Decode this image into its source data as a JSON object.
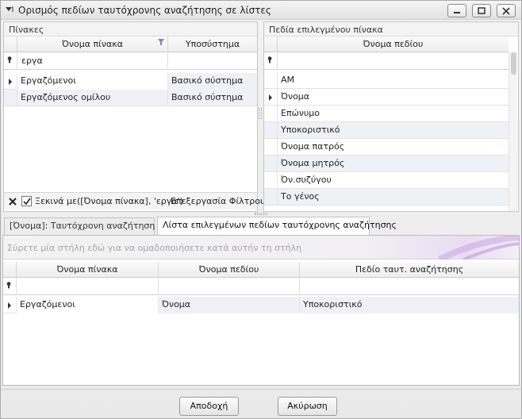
{
  "window": {
    "title": "Ορισμός πεδίων ταυτόχρονης αναζήτησης σε λίστες"
  },
  "tables_panel": {
    "caption": "Πίνακες",
    "columns": [
      "Όνομα πίνακα",
      "Υποσύστημα"
    ],
    "filter_value": "εργα",
    "rows": [
      [
        "Εργαζόμενοι",
        "Βασικό σύστημα"
      ],
      [
        "Εργαζόμενος ομίλου",
        "Βασικό σύστημα"
      ]
    ],
    "filter_bar": {
      "expression": "Ξεκινά με([Όνομα πίνακα], 'εργα')",
      "edit_filter_label": "Επεξεργασία Φίλτρου"
    }
  },
  "fields_panel": {
    "caption": "Πεδία επιλεγμένου πίνακα",
    "columns": [
      "Όνομα πεδίου"
    ],
    "rows": [
      "ΑΜ",
      "Όνομα",
      "Επώνυμο",
      "Υποκοριστικό",
      "Όνομα πατρός",
      "Όνομα μητρός",
      "Όν.συζύγου",
      "Το γένος"
    ]
  },
  "tabs": [
    "[Όνομα]: Ταυτόχρονη αναζήτηση με",
    "Λίστα επιλεγμένων πεδίων ταυτόχρονης αναζήτησης"
  ],
  "bottom_grid": {
    "group_panel_hint": "Σύρετε μία στήλη εδώ για να ομαδοποιήσετε κατά αυτήν τη στήλη",
    "columns": [
      "Όνομα πίνακα",
      "Όνομα πεδίου",
      "Πεδίο ταυτ. αναζήτησης"
    ],
    "rows": [
      [
        "Εργαζόμενοι",
        "Όνομα",
        "Υποκοριστικό"
      ]
    ]
  },
  "buttons": {
    "ok": "Αποδοχή",
    "cancel": "Ακύρωση"
  },
  "colors": {
    "selection_row": "#eef1f6",
    "accent_purple": "#b58ad6"
  }
}
